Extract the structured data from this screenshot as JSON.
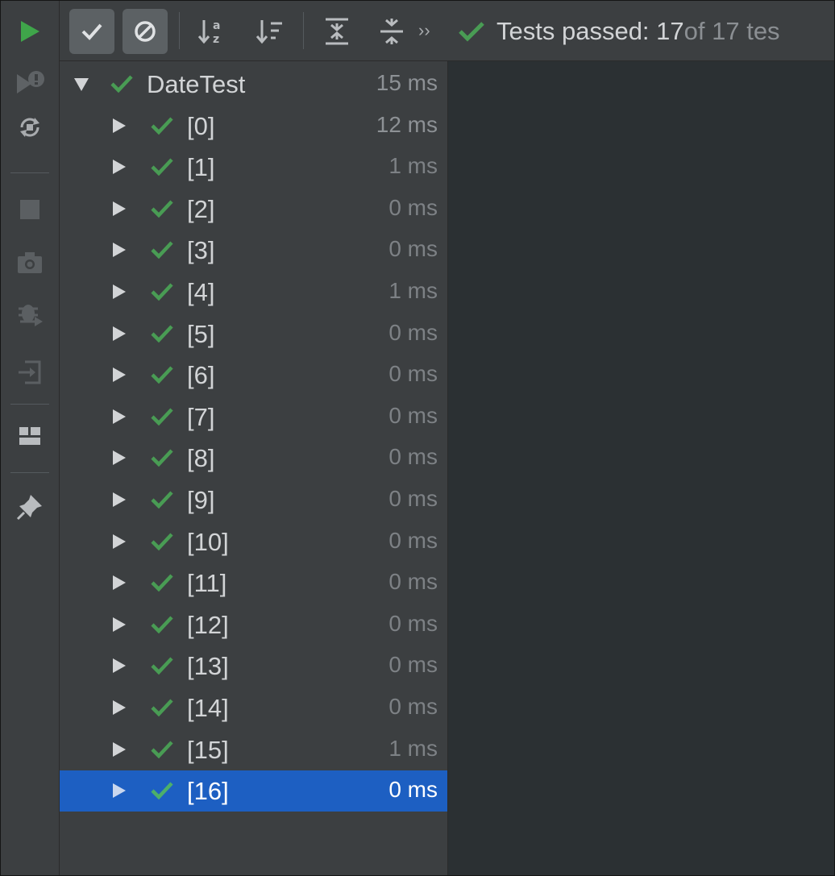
{
  "status": {
    "prefix": "Tests passed: 17",
    "suffix": " of 17 tes"
  },
  "toolbar": {
    "buttons": [
      {
        "name": "show-passed-toggle",
        "icon": "check-icon"
      },
      {
        "name": "show-ignored-toggle",
        "icon": "ignored-icon"
      },
      {
        "name": "sort-alphabetically-button",
        "icon": "sort-alpha-icon"
      },
      {
        "name": "sort-by-duration-button",
        "icon": "sort-duration-icon"
      },
      {
        "name": "expand-all-button",
        "icon": "expand-all-icon"
      },
      {
        "name": "collapse-all-button",
        "icon": "collapse-all-icon"
      },
      {
        "name": "more-actions-button",
        "icon": "double-chevron-right-icon"
      }
    ]
  },
  "left_toolbar": [
    "run-icon",
    "rerun-failed-icon",
    "toggle-auto-test-icon",
    "stop-icon",
    "camera-icon",
    "debug-icon",
    "export-icon",
    "layout-icon",
    "pin-icon"
  ],
  "colors": {
    "green": "#499c54",
    "selection": "#1d5fc2",
    "run_green": "#3fa54a"
  },
  "tree": {
    "root": {
      "label": "DateTest",
      "time": "15 ms"
    },
    "children": [
      {
        "label": "[0]",
        "time": "12 ms"
      },
      {
        "label": "[1]",
        "time": "1 ms"
      },
      {
        "label": "[2]",
        "time": "0 ms"
      },
      {
        "label": "[3]",
        "time": "0 ms"
      },
      {
        "label": "[4]",
        "time": "1 ms"
      },
      {
        "label": "[5]",
        "time": "0 ms"
      },
      {
        "label": "[6]",
        "time": "0 ms"
      },
      {
        "label": "[7]",
        "time": "0 ms"
      },
      {
        "label": "[8]",
        "time": "0 ms"
      },
      {
        "label": "[9]",
        "time": "0 ms"
      },
      {
        "label": "[10]",
        "time": "0 ms"
      },
      {
        "label": "[11]",
        "time": "0 ms"
      },
      {
        "label": "[12]",
        "time": "0 ms"
      },
      {
        "label": "[13]",
        "time": "0 ms"
      },
      {
        "label": "[14]",
        "time": "0 ms"
      },
      {
        "label": "[15]",
        "time": "1 ms"
      },
      {
        "label": "[16]",
        "time": "0 ms",
        "selected": true
      }
    ]
  }
}
